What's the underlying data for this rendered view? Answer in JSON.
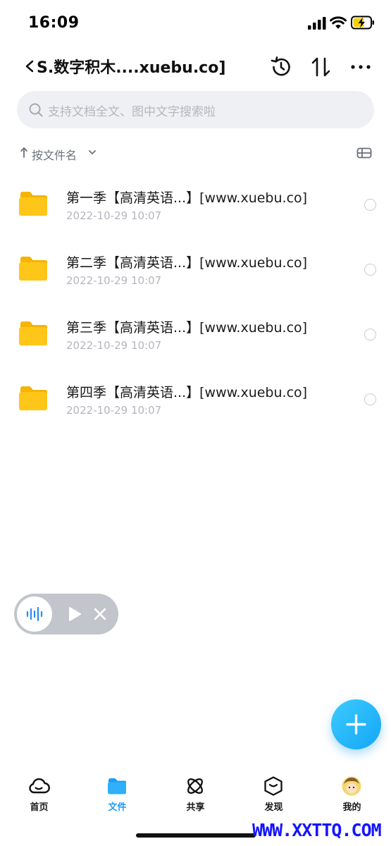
{
  "status_bar": {
    "time": "16:09"
  },
  "nav": {
    "title": "S.数字积木....xuebu.co]"
  },
  "search": {
    "placeholder": "支持文档全文、图中文字搜索啦"
  },
  "sort": {
    "label": "按文件名"
  },
  "files": [
    {
      "name": "第一季【高清英语...】[www.xuebu.co]",
      "date": "2022-10-29 10:07"
    },
    {
      "name": "第二季【高清英语...】[www.xuebu.co]",
      "date": "2022-10-29 10:07"
    },
    {
      "name": "第三季【高清英语...】[www.xuebu.co]",
      "date": "2022-10-29 10:07"
    },
    {
      "name": "第四季【高清英语...】[www.xuebu.co]",
      "date": "2022-10-29 10:07"
    }
  ],
  "tabs": [
    {
      "label": "首页"
    },
    {
      "label": "文件"
    },
    {
      "label": "共享"
    },
    {
      "label": "发现"
    },
    {
      "label": "我的"
    }
  ],
  "watermark": "WWW.XXTTQ.COM",
  "colors": {
    "accent": "#1e9bf5",
    "folder": "#ffc61a",
    "fab": "#13a6f5"
  }
}
